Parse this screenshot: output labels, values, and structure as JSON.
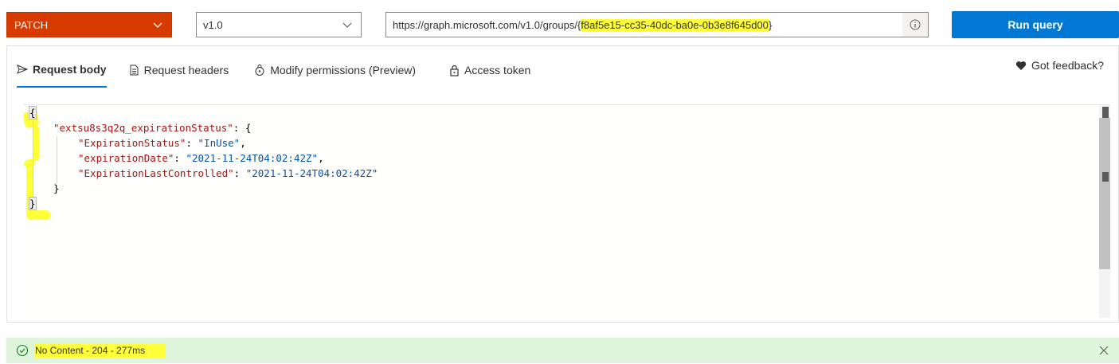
{
  "toolbar": {
    "method": "PATCH",
    "version": "v1.0",
    "url_prefix": "https://graph.microsoft.com/v1.0/groups/{",
    "url_highlighted": "f8af5e15-cc35-40dc-ba0e-0b3e8f645d00",
    "url_suffix": "}",
    "run_label": "Run query",
    "icons": {
      "method_chevron": "chevron-down-icon",
      "version_chevron": "chevron-down-icon",
      "url_info": "info-icon"
    }
  },
  "tabs": [
    {
      "label": "Request body",
      "icon": "send-icon",
      "active": true
    },
    {
      "label": "Request headers",
      "icon": "document-icon",
      "active": false
    },
    {
      "label": "Modify permissions (Preview)",
      "icon": "shield-lock-icon",
      "active": false
    },
    {
      "label": "Access token",
      "icon": "lock-icon",
      "active": false
    }
  ],
  "feedback": {
    "label": "Got feedback?",
    "icon": "heart-icon"
  },
  "editor": {
    "lines": [
      {
        "text": "{"
      },
      {
        "key": "\"extsu8s3q2q_expirationStatus\"",
        "rest": ": {"
      },
      {
        "key": "\"ExpirationStatus\"",
        "sep": ": ",
        "value": "\"InUse\"",
        "end": ","
      },
      {
        "key": "\"expirationDate\"",
        "sep": ": ",
        "value": "\"2021-11-24T04:02:42Z\"",
        "end": ","
      },
      {
        "key": "\"ExpirationLastControlled\"",
        "sep": ": ",
        "value": "\"2021-11-24T04:02:42Z\"",
        "end": ""
      },
      {
        "text": "}"
      },
      {
        "text": "}"
      }
    ]
  },
  "status": {
    "text": "No Content - 204 - 277ms",
    "icon": "check-circle-icon",
    "close_icon": "close-icon"
  },
  "colors": {
    "method_bg": "#d83b01",
    "run_bg": "#0078d4",
    "status_bg": "#dff6dd",
    "highlight": "#ffff3a",
    "json_key": "#a31515",
    "json_string": "#0451a5"
  }
}
